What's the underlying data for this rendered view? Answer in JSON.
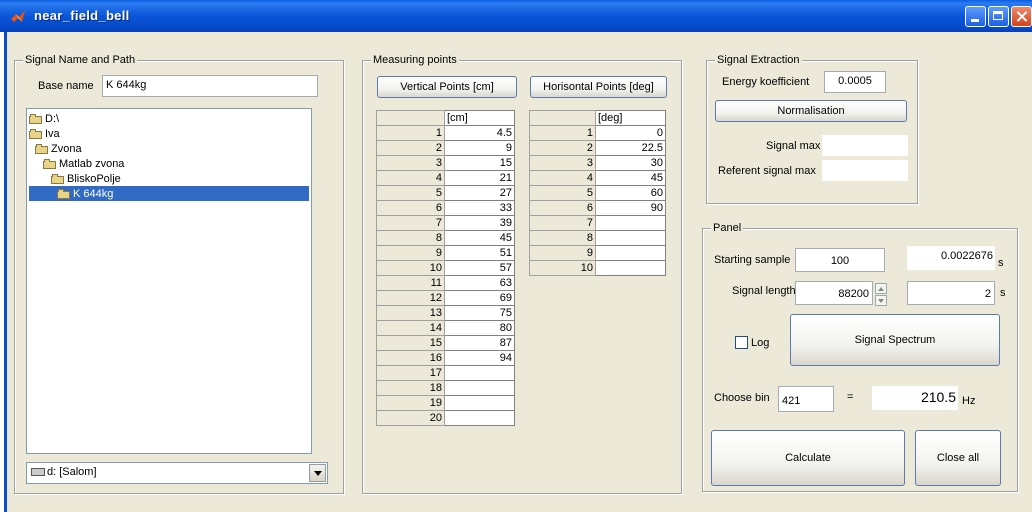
{
  "window": {
    "title": "near_field_bell"
  },
  "signal_panel": {
    "title": "Signal Name and Path",
    "base_name_label": "Base name",
    "base_name_value": "K 644kg",
    "tree": [
      {
        "label": "D:\\",
        "level": 0,
        "selected": false
      },
      {
        "label": "Iva",
        "level": 0,
        "selected": false
      },
      {
        "label": "Zvona",
        "level": 1,
        "selected": false
      },
      {
        "label": "Matlab zvona",
        "level": 2,
        "selected": false
      },
      {
        "label": "BliskoPolje",
        "level": 3,
        "selected": false
      },
      {
        "label": "K 644kg",
        "level": 4,
        "selected": true
      }
    ],
    "drive_select": "d: [Salom]"
  },
  "measuring": {
    "title": "Measuring points",
    "vertical_button": "Vertical Points [cm]",
    "horizontal_button": "Horisontal Points [deg]",
    "vertical_header": "[cm]",
    "horizontal_header": "[deg]",
    "vertical": [
      {
        "idx": "1",
        "val": "4.5"
      },
      {
        "idx": "2",
        "val": "9"
      },
      {
        "idx": "3",
        "val": "15"
      },
      {
        "idx": "4",
        "val": "21"
      },
      {
        "idx": "5",
        "val": "27"
      },
      {
        "idx": "6",
        "val": "33"
      },
      {
        "idx": "7",
        "val": "39"
      },
      {
        "idx": "8",
        "val": "45"
      },
      {
        "idx": "9",
        "val": "51"
      },
      {
        "idx": "10",
        "val": "57"
      },
      {
        "idx": "11",
        "val": "63"
      },
      {
        "idx": "12",
        "val": "69"
      },
      {
        "idx": "13",
        "val": "75"
      },
      {
        "idx": "14",
        "val": "80"
      },
      {
        "idx": "15",
        "val": "87"
      },
      {
        "idx": "16",
        "val": "94"
      },
      {
        "idx": "17",
        "val": ""
      },
      {
        "idx": "18",
        "val": ""
      },
      {
        "idx": "19",
        "val": ""
      },
      {
        "idx": "20",
        "val": ""
      }
    ],
    "horizontal": [
      {
        "idx": "1",
        "val": "0"
      },
      {
        "idx": "2",
        "val": "22.5"
      },
      {
        "idx": "3",
        "val": "30"
      },
      {
        "idx": "4",
        "val": "45"
      },
      {
        "idx": "5",
        "val": "60"
      },
      {
        "idx": "6",
        "val": "90"
      },
      {
        "idx": "7",
        "val": ""
      },
      {
        "idx": "8",
        "val": ""
      },
      {
        "idx": "9",
        "val": ""
      },
      {
        "idx": "10",
        "val": ""
      }
    ]
  },
  "extraction": {
    "title": "Signal Extraction",
    "energy_label": "Energy koefficient",
    "energy_value": "0.0005",
    "normalisation_button": "Normalisation",
    "signal_max_label": "Signal max",
    "signal_max_value": "",
    "ref_signal_max_label": "Referent signal max",
    "ref_signal_max_value": ""
  },
  "panel": {
    "title": "Panel",
    "starting_sample_label": "Starting sample",
    "starting_sample_value": "100",
    "starting_time": "0.0022676",
    "unit_s": "s",
    "signal_length_label": "Signal length",
    "signal_length_value": "88200",
    "signal_length_time": "2",
    "log_label": "Log",
    "spectrum_button": "Signal Spectrum",
    "choose_bin_label": "Choose bin",
    "bin_value": "421",
    "equals": "=",
    "freq_value": "210.5",
    "freq_unit": "Hz",
    "calculate_button": "Calculate",
    "close_button": "Close all"
  }
}
